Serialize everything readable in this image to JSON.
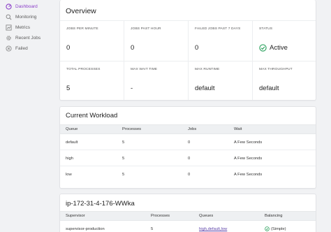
{
  "sidebar": {
    "items": [
      {
        "label": "Dashboard",
        "icon": "dashboard-icon"
      },
      {
        "label": "Monitoring",
        "icon": "search-icon"
      },
      {
        "label": "Metrics",
        "icon": "chart-icon"
      },
      {
        "label": "Recent Jobs",
        "icon": "gear-icon"
      },
      {
        "label": "Failed",
        "icon": "close-circle-icon"
      }
    ],
    "active_color": "#8b3ec8"
  },
  "overview": {
    "title": "Overview",
    "stats": [
      {
        "label": "JOBS PER MINUTE",
        "value": "0"
      },
      {
        "label": "JOBS PAST HOUR",
        "value": "0"
      },
      {
        "label": "FAILED JOBS PAST 7 DAYS",
        "value": "0"
      },
      {
        "label": "STATUS",
        "value": "Active"
      },
      {
        "label": "TOTAL PROCESSES",
        "value": "5"
      },
      {
        "label": "MAX WAIT TIME",
        "value": "-"
      },
      {
        "label": "MAX RUNTIME",
        "value": "default"
      },
      {
        "label": "MAX THROUGHPUT",
        "value": "default"
      }
    ],
    "status_color": "#2fa360"
  },
  "workload": {
    "title": "Current Workload",
    "columns": [
      "Queue",
      "Processes",
      "Jobs",
      "Wait"
    ],
    "rows": [
      [
        "default",
        "5",
        "0",
        "A Few Seconds"
      ],
      [
        "high",
        "5",
        "0",
        "A Few Seconds"
      ],
      [
        "low",
        "5",
        "0",
        "A Few Seconds"
      ]
    ]
  },
  "supervisor": {
    "title": "ip-172-31-4-176-WWka",
    "columns": [
      "Supervisor",
      "Processes",
      "Queues",
      "Balancing"
    ],
    "rows": [
      [
        "supervisor-production",
        "5",
        "high,default,low",
        "(Simple)"
      ]
    ]
  }
}
